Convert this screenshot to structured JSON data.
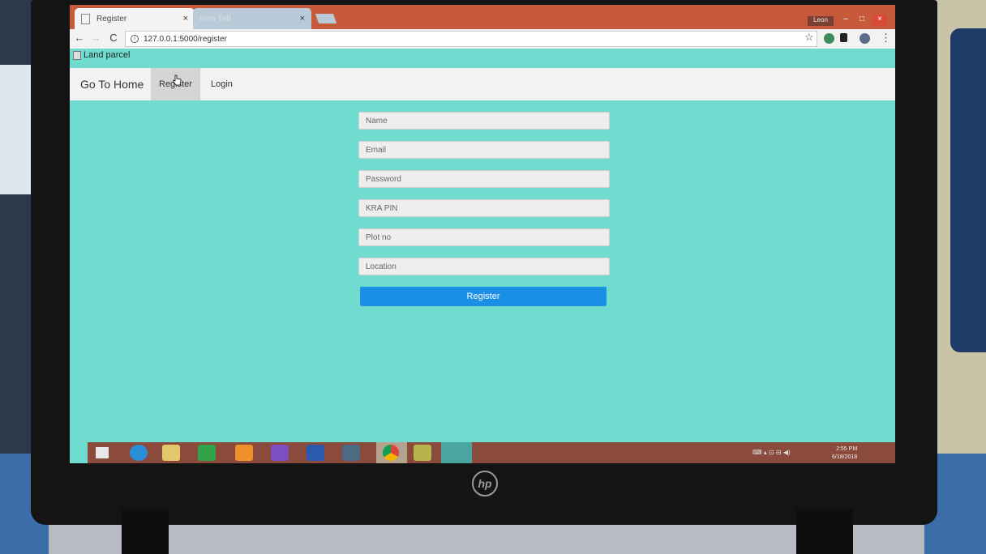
{
  "browser": {
    "tabs": [
      {
        "label": "Register",
        "close": "×"
      },
      {
        "label": "New Tab",
        "close": "×"
      }
    ],
    "user": "Leon",
    "address": "127.0.0.1:5000/register",
    "nav": {
      "back": "←",
      "forward": "→",
      "reload": "C"
    },
    "window": {
      "minimize": "–",
      "maximize": "□",
      "close": "×"
    },
    "menu_glyph": "⋮",
    "star_glyph": "☆"
  },
  "page": {
    "logo_alt": "Land parcel",
    "nav": {
      "brand": "Go To Home",
      "register": "Register",
      "login": "Login"
    },
    "form": {
      "name_placeholder": "Name",
      "email_placeholder": "Email",
      "password_placeholder": "Password",
      "kra_placeholder": "KRA PIN",
      "plot_placeholder": "Plot no",
      "location_placeholder": "Location",
      "submit_label": "Register"
    },
    "background_color": "#6fdccf",
    "button_color": "#1a8fe3"
  },
  "taskbar": {
    "clock_time": "2:55 PM",
    "clock_date": "6/18/2018"
  },
  "device": {
    "brand": "hp"
  }
}
